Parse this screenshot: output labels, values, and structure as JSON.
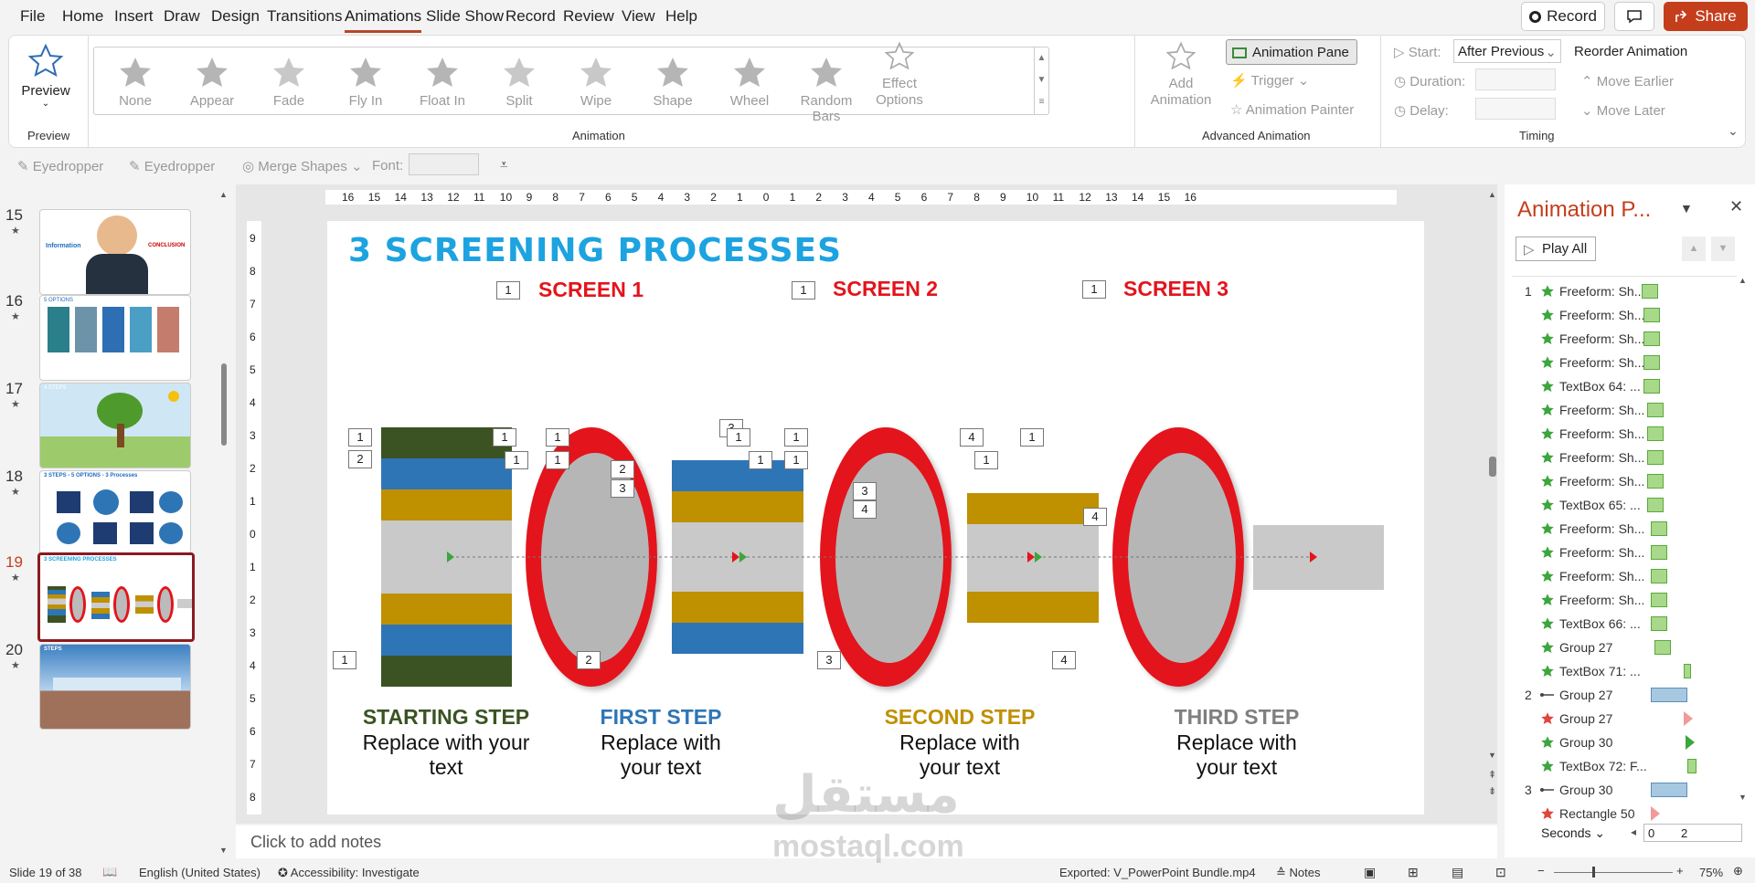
{
  "menu": [
    "File",
    "Home",
    "Insert",
    "Draw",
    "Design",
    "Transitions",
    "Animations",
    "Slide Show",
    "Record",
    "Review",
    "View",
    "Help"
  ],
  "menu_active": "Animations",
  "topbar": {
    "record": "Record",
    "share": "Share"
  },
  "ribbon": {
    "preview": "Preview",
    "preview_group": "Preview",
    "animations": [
      "None",
      "Appear",
      "Fade",
      "Fly In",
      "Float In",
      "Split",
      "Wipe",
      "Shape",
      "Wheel",
      "Random Bars"
    ],
    "effect_options": "Effect Options",
    "animation_group": "Animation",
    "add_animation": "Add Animation",
    "animation_pane": "Animation Pane",
    "trigger": "Trigger",
    "animation_painter": "Animation Painter",
    "advanced_group": "Advanced Animation",
    "start_label": "Start:",
    "start_value": "After Previous",
    "duration_label": "Duration:",
    "delay_label": "Delay:",
    "timing_group": "Timing",
    "reorder": "Reorder Animation",
    "move_earlier": "Move Earlier",
    "move_later": "Move Later"
  },
  "qat": {
    "eyedropper1": "Eyedropper",
    "eyedropper2": "Eyedropper",
    "merge": "Merge Shapes",
    "font_label": "Font:"
  },
  "thumbnails": [
    {
      "num": "15",
      "title": "Information",
      "note": "CONCLUSION"
    },
    {
      "num": "16",
      "title": "5 OPTIONS"
    },
    {
      "num": "17",
      "title": "4 STEPS"
    },
    {
      "num": "18",
      "title": "3 STEPS - 5 OPTIONS - 3 Processes"
    },
    {
      "num": "19",
      "title": "3 SCREENING PROCESSES"
    },
    {
      "num": "20",
      "title": "STEPS"
    }
  ],
  "slide": {
    "title": "3 SCREENING PROCESSES",
    "screens": [
      "SCREEN 1",
      "SCREEN 2",
      "SCREEN 3"
    ],
    "steps": [
      {
        "title": "STARTING STEP",
        "text": "Replace with your text",
        "color": "#3b5323"
      },
      {
        "title": "FIRST STEP",
        "text": "Replace with your text",
        "color": "#2e75b6"
      },
      {
        "title": "SECOND STEP",
        "text": "Replace with your text",
        "color": "#bf9000"
      },
      {
        "title": "THIRD STEP",
        "text": "Replace with your text",
        "color": "#7f7f7f"
      }
    ],
    "tags": [
      "1",
      "1",
      "1",
      "1",
      "2",
      "1",
      "1",
      "1",
      "2",
      "3",
      "3",
      "1",
      "1",
      "1",
      "1",
      "3",
      "4",
      "1",
      "4",
      "1",
      "1",
      "4",
      "1",
      "2",
      "3",
      "4"
    ]
  },
  "ruler_h": [
    "16",
    "15",
    "14",
    "13",
    "12",
    "11",
    "10",
    "9",
    "8",
    "7",
    "6",
    "5",
    "4",
    "3",
    "2",
    "1",
    "0",
    "1",
    "2",
    "3",
    "4",
    "5",
    "6",
    "7",
    "8",
    "9",
    "10",
    "11",
    "12",
    "13",
    "14",
    "15",
    "16"
  ],
  "ruler_v": [
    "9",
    "8",
    "7",
    "6",
    "5",
    "4",
    "3",
    "2",
    "1",
    "0",
    "1",
    "2",
    "3",
    "4",
    "5",
    "6",
    "7",
    "8"
  ],
  "notes": "Click to add notes",
  "pane": {
    "title": "Animation P...",
    "play_all": "Play All",
    "items": [
      {
        "n": "1",
        "label": "Freeform: Sh...",
        "type": "entrance",
        "bar": "green"
      },
      {
        "n": "",
        "label": "Freeform: Sh...",
        "type": "entrance",
        "bar": "green"
      },
      {
        "n": "",
        "label": "Freeform: Sh...",
        "type": "entrance",
        "bar": "green"
      },
      {
        "n": "",
        "label": "Freeform: Sh...",
        "type": "entrance",
        "bar": "green"
      },
      {
        "n": "",
        "label": "TextBox 64: ...",
        "type": "entrance-big",
        "bar": "green"
      },
      {
        "n": "",
        "label": "Freeform: Sh...",
        "type": "entrance",
        "bar": "green"
      },
      {
        "n": "",
        "label": "Freeform: Sh...",
        "type": "entrance",
        "bar": "green"
      },
      {
        "n": "",
        "label": "Freeform: Sh...",
        "type": "entrance",
        "bar": "green"
      },
      {
        "n": "",
        "label": "Freeform: Sh...",
        "type": "entrance",
        "bar": "green"
      },
      {
        "n": "",
        "label": "TextBox 65: ...",
        "type": "entrance-big",
        "bar": "green"
      },
      {
        "n": "",
        "label": "Freeform: Sh...",
        "type": "entrance",
        "bar": "green"
      },
      {
        "n": "",
        "label": "Freeform: Sh...",
        "type": "entrance",
        "bar": "green"
      },
      {
        "n": "",
        "label": "Freeform: Sh...",
        "type": "entrance",
        "bar": "green"
      },
      {
        "n": "",
        "label": "Freeform: Sh...",
        "type": "entrance",
        "bar": "green"
      },
      {
        "n": "",
        "label": "TextBox 66: ...",
        "type": "entrance-big",
        "bar": "green"
      },
      {
        "n": "",
        "label": "Group 27",
        "type": "entrance",
        "bar": "green"
      },
      {
        "n": "",
        "label": "TextBox 71: ...",
        "type": "entrance-big",
        "bar": "green"
      },
      {
        "n": "2",
        "label": "Group 27",
        "type": "motion",
        "bar": "blue"
      },
      {
        "n": "",
        "label": "Group 27",
        "type": "exit",
        "bar": "red-tri"
      },
      {
        "n": "",
        "label": "Group 30",
        "type": "entrance-big",
        "bar": "green-tri"
      },
      {
        "n": "",
        "label": "TextBox 72: F...",
        "type": "entrance-big",
        "bar": "green"
      },
      {
        "n": "3",
        "label": "Group 30",
        "type": "motion",
        "bar": "blue"
      },
      {
        "n": "",
        "label": "Rectangle 50",
        "type": "exit",
        "bar": "red-tri"
      }
    ],
    "seconds": "Seconds",
    "sec_values": [
      "0",
      "2"
    ]
  },
  "status": {
    "slide": "Slide 19 of 38",
    "lang": "English (United States)",
    "access": "Accessibility: Investigate",
    "exported": "Exported: V_PowerPoint Bundle.mp4",
    "notes": "Notes",
    "zoom": "75%"
  },
  "watermark": {
    "ar": "مستقل",
    "en": "mostaql.com"
  },
  "colors": {
    "accent": "#b7472a",
    "share": "#c43e1c",
    "title": "#1ca3e0",
    "red": "#e3141c"
  }
}
